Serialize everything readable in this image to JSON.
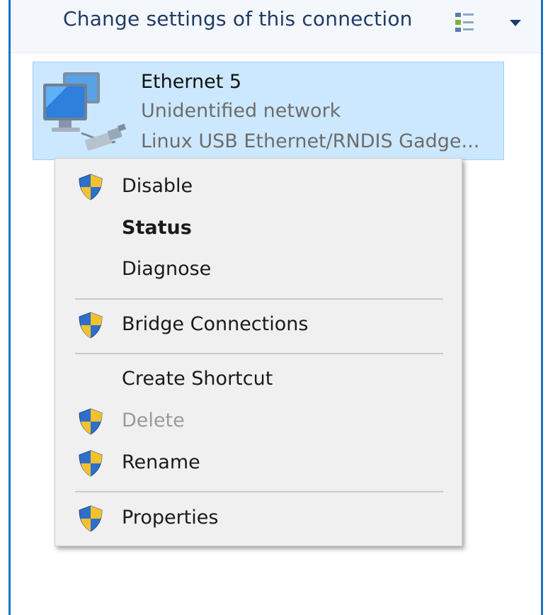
{
  "toolbar": {
    "change_settings_label": "Change settings of this connection",
    "view_icon": "view-list-icon",
    "dropdown_icon": "chevron-down-icon"
  },
  "connection": {
    "name": "Ethernet 5",
    "status": "Unidentified network",
    "device": "Linux USB Ethernet/RNDIS Gadge...",
    "icon": "network-adapter-icon",
    "selection_color": "#cce8ff"
  },
  "context_menu": {
    "items": [
      {
        "label": "Disable",
        "shield": true,
        "bold": false,
        "disabled": false
      },
      {
        "label": "Status",
        "shield": false,
        "bold": true,
        "disabled": false
      },
      {
        "label": "Diagnose",
        "shield": false,
        "bold": false,
        "disabled": false
      },
      {
        "label": "Bridge Connections",
        "shield": true,
        "bold": false,
        "disabled": false
      },
      {
        "label": "Create Shortcut",
        "shield": false,
        "bold": false,
        "disabled": false
      },
      {
        "label": "Delete",
        "shield": true,
        "bold": false,
        "disabled": true
      },
      {
        "label": "Rename",
        "shield": true,
        "bold": false,
        "disabled": false
      },
      {
        "label": "Properties",
        "shield": true,
        "bold": false,
        "disabled": false
      }
    ]
  },
  "colors": {
    "shield_blue": "#2f6fc9",
    "shield_yellow": "#f2c12e",
    "frame_border": "#1a73c8"
  }
}
